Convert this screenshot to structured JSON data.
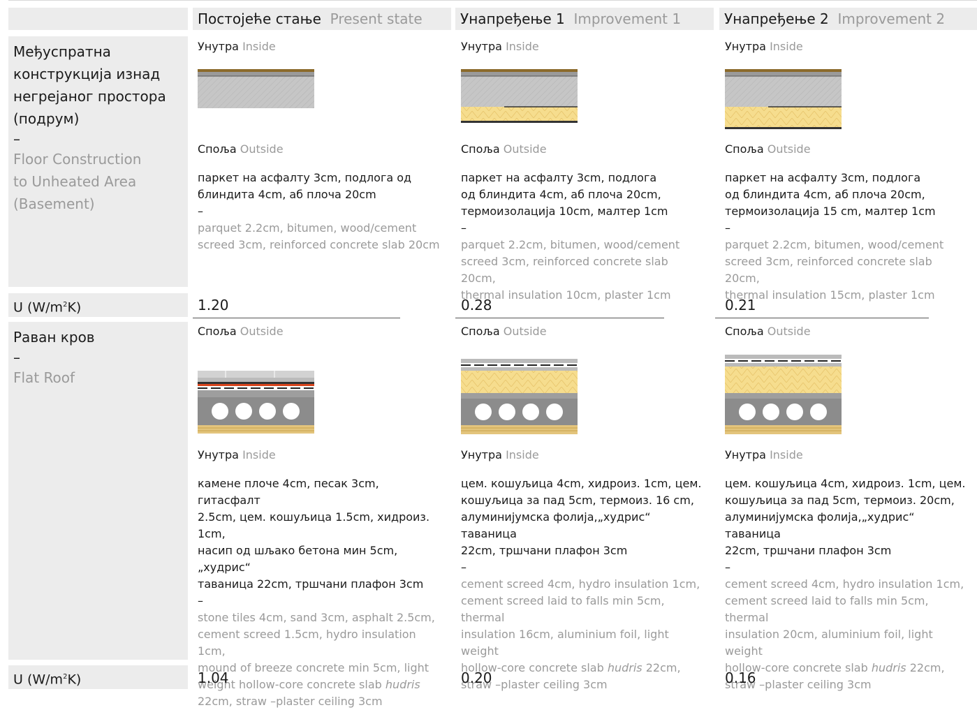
{
  "headers": [
    {
      "sr": "Постојеће стање",
      "en": "Present state"
    },
    {
      "sr": "Унапређење 1",
      "en": "Improvement 1"
    },
    {
      "sr": "Унапређење 2",
      "en": "Improvement 2"
    }
  ],
  "labels": {
    "inside_sr": "Унутра",
    "inside_en": "Inside",
    "outside_sr": "Споља",
    "outside_en": "Outside",
    "dash": "–",
    "u_label": "U (W/m",
    "u_sup": "2",
    "u_suffix": "K)"
  },
  "floor": {
    "title_sr": [
      "Међуспратна",
      "конструкција изнад",
      "негрејаног простора",
      "(подрум)"
    ],
    "title_en": [
      "Floor Construction",
      "to Unheated Area",
      "(Basement)"
    ],
    "cols": [
      {
        "sr": [
          "паркет на асфалту 3cm, подлога од",
          "блиндита 4cm, аб плоча 20cm"
        ],
        "en": [
          "parquet 2.2cm, bitumen, wood/cement",
          "screed 3cm, reinforced concrete slab 20cm"
        ],
        "u": "1.20"
      },
      {
        "sr": [
          "паркет на асфалту 3cm, подлога",
          "од блиндита 4cm, аб плоча 20cm,",
          "термоизолација 10cm, малтер 1cm"
        ],
        "en": [
          "parquet 2.2cm, bitumen, wood/cement",
          "screed 3cm, reinforced concrete slab 20cm,",
          "thermal insulation 10cm, plaster 1cm"
        ],
        "u": "0.28"
      },
      {
        "sr": [
          "паркет на асфалту 3cm, подлога",
          "од блиндита 4cm, аб плоча 20cm,",
          "термоизолација 15 cm, малтер 1cm"
        ],
        "en": [
          "parquet 2.2cm, bitumen, wood/cement",
          "screed 3cm, reinforced concrete slab 20cm,",
          "thermal insulation 15cm, plaster 1cm"
        ],
        "u": "0.21"
      }
    ]
  },
  "roof": {
    "title_sr": "Раван кров",
    "title_en": "Flat Roof",
    "cols": [
      {
        "sr": [
          "камене плоче 4cm, песак 3cm, гитасфалт",
          "2.5cm, цем. кошуљица 1.5cm, хидроиз. 1cm,",
          "насип од шљако бетона мин 5cm,„худрис“",
          "таваница 22cm, тршчани плафон 3cm"
        ],
        "en_lines": [
          {
            "a": "stone tiles 4cm, sand 3cm, asphalt 2.5cm,"
          },
          {
            "a": "cement screed 1.5cm, hydro insulation 1cm,"
          },
          {
            "a": "mound of breeze concrete min 5cm, light"
          },
          {
            "a": "weight hollow-core concrete slab ",
            "i": "hudris"
          },
          {
            "a": "22cm, straw –plaster ceiling 3cm"
          }
        ],
        "u": "1.04"
      },
      {
        "sr": [
          "цем. кошуљица 4cm, хидроиз. 1cm, цем.",
          "кошуљица за пад 5cm, термоиз. 16 cm,",
          "алуминијумска фолија,„худрис“ таваница",
          "22cm, тршчани плафон 3cm"
        ],
        "en_lines": [
          {
            "a": "cement screed 4cm, hydro insulation 1cm,"
          },
          {
            "a": "cement screed laid to falls min 5cm, thermal"
          },
          {
            "a": "insulation 16cm, aluminium foil, light weight"
          },
          {
            "a": "hollow-core concrete slab ",
            "i": "hudris",
            "b": " 22cm,"
          },
          {
            "a": "straw –plaster ceiling 3cm"
          }
        ],
        "u": "0.20"
      },
      {
        "sr": [
          "цем. кошуљица 4cm, хидроиз. 1cm, цем.",
          "кошуљица за пад 5cm, термоиз. 20cm,",
          "алуминијумска фолија,„худрис“ таваница",
          "22cm, тршчани плафон 3cm"
        ],
        "en_lines": [
          {
            "a": "cement screed 4cm, hydro insulation 1cm,"
          },
          {
            "a": "cement screed laid to falls min 5cm, thermal"
          },
          {
            "a": "insulation 20cm, aluminium foil, light weight"
          },
          {
            "a": "hollow-core concrete slab ",
            "i": "hudris",
            "b": " 22cm,"
          },
          {
            "a": "straw –plaster ceiling 3cm"
          }
        ],
        "u": "0.16"
      }
    ]
  },
  "colors": {
    "band": "#ececec",
    "concrete": "#c4c4c4",
    "insulation": "#f5dc8c",
    "wood": "#8a6a2a",
    "muted": "#9a9a9a"
  }
}
